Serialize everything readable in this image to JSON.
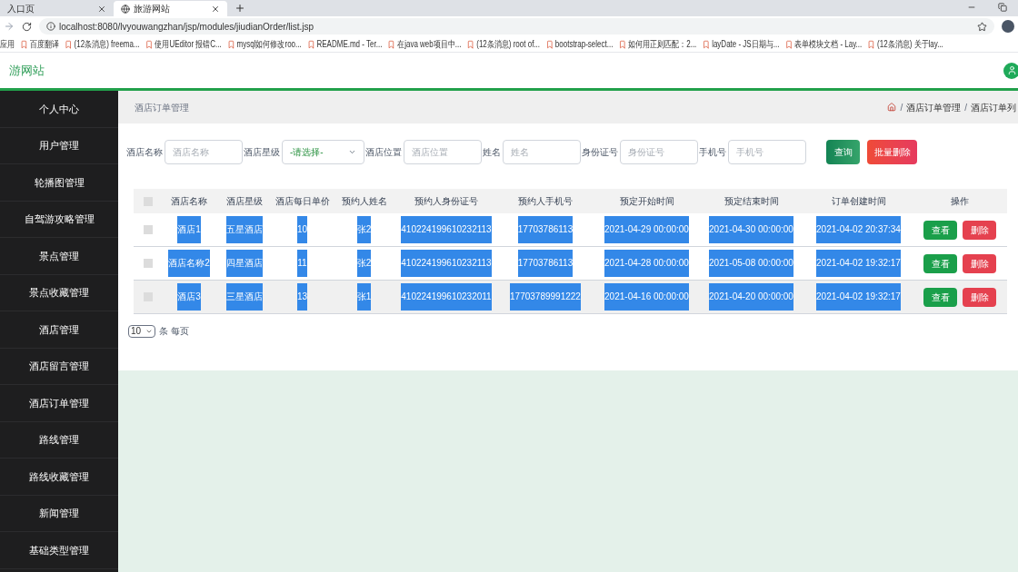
{
  "browser": {
    "tabs": [
      {
        "title": "入口页",
        "selected": false
      },
      {
        "title": "旅游网站",
        "selected": true
      }
    ],
    "url": "localhost:8080/lvyouwangzhan/jsp/modules/jiudianOrder/list.jsp",
    "bookmarks": [
      "应用",
      "百度翻译",
      "(12条消息) freema...",
      "使用UEditor 报错C...",
      "mysql如何修改roo...",
      "README.md - Ter...",
      "在java web项目中...",
      "(12条消息) root of...",
      "bootstrap-select...",
      "如何用正则匹配：2...",
      "layDate - JS日期与...",
      "表单模块文档 - Lay...",
      "(12条消息) 关于lay..."
    ]
  },
  "header": {
    "title": "游网站"
  },
  "sidebar": {
    "items": [
      {
        "label": "个人中心",
        "selected": false
      },
      {
        "label": "用户管理",
        "selected": false
      },
      {
        "label": "轮播图管理",
        "selected": false
      },
      {
        "label": "自驾游攻略管理",
        "selected": false
      },
      {
        "label": "景点管理",
        "selected": false
      },
      {
        "label": "景点收藏管理",
        "selected": false
      },
      {
        "label": "酒店管理",
        "selected": false
      },
      {
        "label": "酒店留言管理",
        "selected": false
      },
      {
        "label": "酒店订单管理",
        "selected": false
      },
      {
        "label": "路线管理",
        "selected": false
      },
      {
        "label": "路线收藏管理",
        "selected": false
      },
      {
        "label": "新闻管理",
        "selected": false
      },
      {
        "label": "基础类型管理",
        "selected": false
      }
    ]
  },
  "page_title": "酒店订单管理",
  "breadcrumb": {
    "separator": "/",
    "items": [
      "酒店订单管理",
      "酒店订单列"
    ]
  },
  "filters": [
    {
      "kind": "input",
      "label": "酒店名称",
      "placeholder": "酒店名称"
    },
    {
      "kind": "select",
      "label": "酒店星级",
      "value": "-请选择-"
    },
    {
      "kind": "input",
      "label": "酒店位置",
      "placeholder": "酒店位置"
    },
    {
      "kind": "input",
      "label": "姓名",
      "placeholder": "姓名"
    },
    {
      "kind": "input",
      "label": "身份证号",
      "placeholder": "身份证号"
    },
    {
      "kind": "input",
      "label": "手机号",
      "placeholder": "手机号"
    }
  ],
  "search_button": "查询",
  "batch_delete_button": "批量删除",
  "table": {
    "header_checked": false,
    "columns": [
      "酒店名称",
      "酒店星级",
      "酒店每日单价",
      "预约人姓名",
      "预约人身份证号",
      "预约人手机号",
      "预定开始时间",
      "预定结束时间",
      "订单创建时间",
      "操作"
    ],
    "rows": [
      {
        "checked": false,
        "hovered": false,
        "highlighted": true,
        "cells": [
          "酒店1",
          "五星酒店",
          "10",
          "张2",
          "410224199610232113",
          "17703786113",
          "2021-04-29 00:00:00",
          "2021-04-30 00:00:00",
          "2021-04-02 20:37:34"
        ],
        "actions": [
          "查看",
          "删除"
        ]
      },
      {
        "checked": false,
        "hovered": false,
        "highlighted": true,
        "cells": [
          "酒店名称2",
          "四星酒店",
          "11",
          "张2",
          "410224199610232113",
          "17703786113",
          "2021-04-28 00:00:00",
          "2021-05-08 00:00:00",
          "2021-04-02 19:32:17"
        ],
        "actions": [
          "查看",
          "删除"
        ]
      },
      {
        "checked": false,
        "hovered": true,
        "highlighted": true,
        "cells": [
          "酒店3",
          "三星酒店",
          "13",
          "张1",
          "410224199610232011",
          "17703789991222",
          "2021-04-16 00:00:00",
          "2021-04-20 00:00:00",
          "2021-04-02 19:32:17"
        ],
        "actions": [
          "查看",
          "删除"
        ]
      }
    ]
  },
  "page_size": {
    "value": "10",
    "label": "条 每页"
  }
}
